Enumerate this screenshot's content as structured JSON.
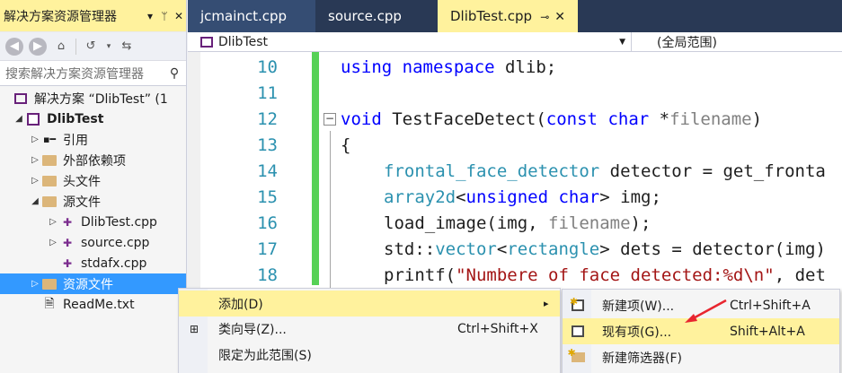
{
  "solution_explorer": {
    "title": "解决方案资源管理器",
    "title_buttons": [
      "▾",
      "🖈",
      "✕"
    ],
    "search_placeholder": "搜索解决方案资源管理器",
    "tree": [
      {
        "label": "解决方案 “DlibTest” (1",
        "level": 0,
        "arrow": "",
        "icon": "solution-icon"
      },
      {
        "label": "DlibTest",
        "level": 1,
        "arrow": "◢",
        "icon": "project-icon",
        "bold": true
      },
      {
        "label": "引用",
        "level": 2,
        "arrow": "▷",
        "icon": "references-icon"
      },
      {
        "label": "外部依赖项",
        "level": 2,
        "arrow": "▷",
        "icon": "folder-icon"
      },
      {
        "label": "头文件",
        "level": 2,
        "arrow": "▷",
        "icon": "folder-icon"
      },
      {
        "label": "源文件",
        "level": 2,
        "arrow": "◢",
        "icon": "folder-icon"
      },
      {
        "label": "DlibTest.cpp",
        "level": 3,
        "arrow": "▷",
        "icon": "cpp-file-icon"
      },
      {
        "label": "source.cpp",
        "level": 3,
        "arrow": "▷",
        "icon": "cpp-file-icon"
      },
      {
        "label": "stdafx.cpp",
        "level": 3,
        "arrow": "",
        "icon": "cpp-file-icon"
      },
      {
        "label": "资源文件",
        "level": 2,
        "arrow": "▷",
        "icon": "folder-icon",
        "selected": true
      },
      {
        "label": "ReadMe.txt",
        "level": 2,
        "arrow": "",
        "icon": "text-file-icon"
      }
    ]
  },
  "tabs": [
    {
      "label": "jcmainct.cpp"
    },
    {
      "label": "source.cpp"
    },
    {
      "label": "DlibTest.cpp",
      "active": true
    }
  ],
  "navbar": {
    "project": "DlibTest",
    "scope": "(全局范围)"
  },
  "code_lines": [
    {
      "num": "10"
    },
    {
      "num": "11"
    },
    {
      "num": "12"
    },
    {
      "num": "13"
    },
    {
      "num": "14"
    },
    {
      "num": "15"
    },
    {
      "num": "16"
    },
    {
      "num": "17"
    },
    {
      "num": "18"
    }
  ],
  "code_text": {
    "l10_kw1": "using",
    "l10_kw2": "namespace",
    "l10_rest": " dlib;",
    "l12_kw": "void",
    "l12_fn": " TestFaceDetect(",
    "l12_kw2": "const",
    "l12_kw3": "char",
    "l12_star": " *",
    "l12_par": "filename",
    "l12_end": ")",
    "l13": "{",
    "l14_ty": "frontal_face_detector",
    "l14_rest": " detector = get_fronta",
    "l15_ty": "array2d",
    "l15_lt": "<",
    "l15_kw": "unsigned char",
    "l15_rest": "> img;",
    "l16_fn": "load_image(img, ",
    "l16_par": "filename",
    "l16_end": ");",
    "l17_std": "std::",
    "l17_ty": "vector",
    "l17_lt": "<",
    "l17_ty2": "rectangle",
    "l17_rest": "> dets = detector(img)",
    "l18_fn": "printf(",
    "l18_str": "\"Numbere of face detected:%d\\n\"",
    "l18_rest": ", det"
  },
  "context_menu": {
    "items": [
      {
        "label": "添加(D)",
        "shortcut": "",
        "has_submenu": true,
        "highlighted": true
      },
      {
        "label": "类向导(Z)...",
        "shortcut": "Ctrl+Shift+X",
        "icon": "class-wizard-icon"
      },
      {
        "label": "限定为此范围(S)",
        "shortcut": ""
      }
    ],
    "submenu_arrow": "▸"
  },
  "submenu": {
    "items": [
      {
        "label": "新建项(W)...",
        "shortcut": "Ctrl+Shift+A",
        "icon": "new-item-icon"
      },
      {
        "label": "现有项(G)...",
        "shortcut": "Shift+Alt+A",
        "icon": "existing-item-icon",
        "highlighted": true
      },
      {
        "label": "新建筛选器(F)",
        "shortcut": "",
        "icon": "new-filter-icon"
      }
    ]
  },
  "colors": {
    "accent_yellow": "#fff29d",
    "tab_dark": "#293955",
    "selection_blue": "#3399ff",
    "change_bar_green": "#56d156",
    "annotation_arrow": "#e8262f"
  }
}
